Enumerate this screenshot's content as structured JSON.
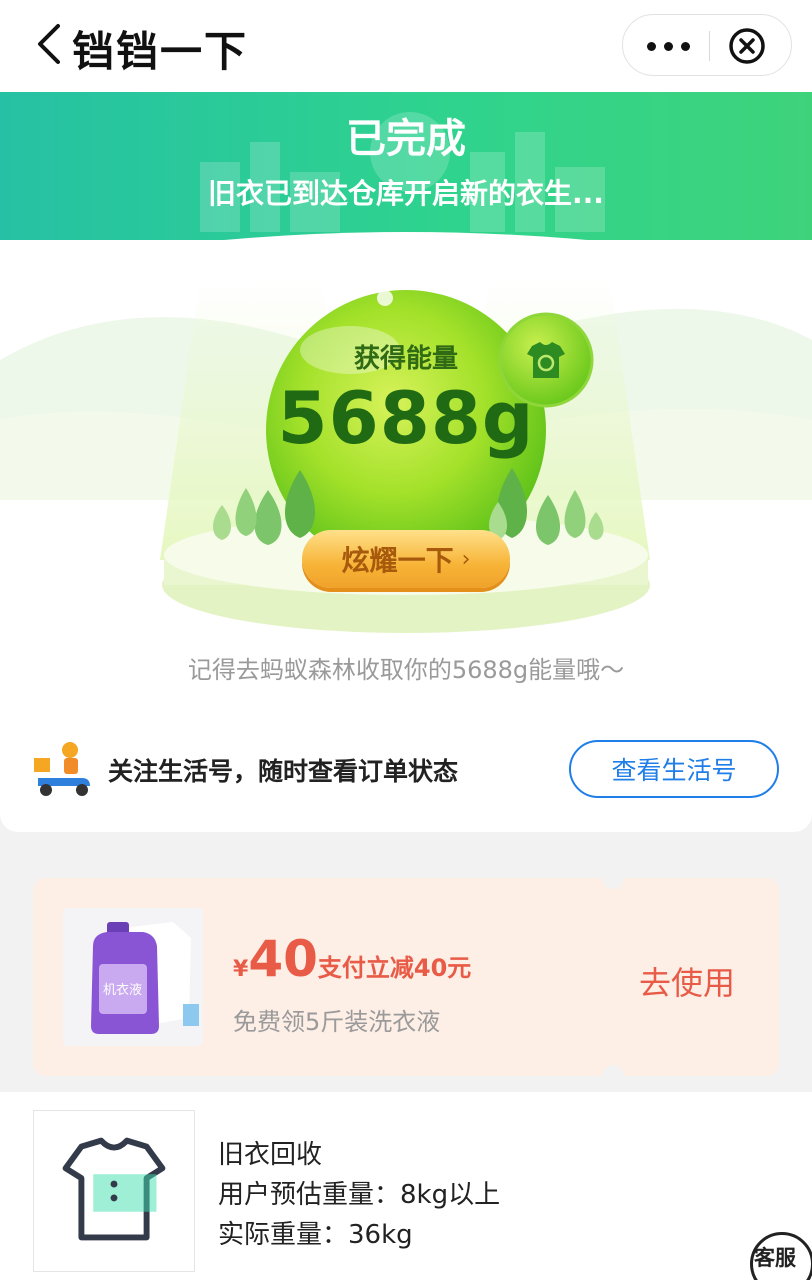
{
  "nav": {
    "title": "铛铛一下"
  },
  "banner": {
    "status": "已完成",
    "subtitle": "旧衣已到达仓库开启新的衣生..."
  },
  "energy": {
    "label": "获得能量",
    "value": "5688g",
    "button": "炫耀一下",
    "reminder": "记得去蚂蚁森林收取你的5688g能量哦～"
  },
  "follow": {
    "text": "关注生活号，随时查看订单状态",
    "button": "查看生活号"
  },
  "coupon": {
    "currency": "¥",
    "amount": "40",
    "desc": "支付立减40元",
    "subtitle": "免费领5斤装洗衣液",
    "action": "去使用",
    "product_label": "机衣液"
  },
  "order": {
    "title": "旧衣回收",
    "estimated": "用户预估重量：8kg以上",
    "actual": "实际重量：36kg"
  },
  "service": {
    "label": "客服"
  },
  "colors": {
    "brand_green": "#2fd38e",
    "energy_green": "#7fd81f",
    "link_blue": "#1f7ee8",
    "coupon_red": "#e85b47"
  }
}
